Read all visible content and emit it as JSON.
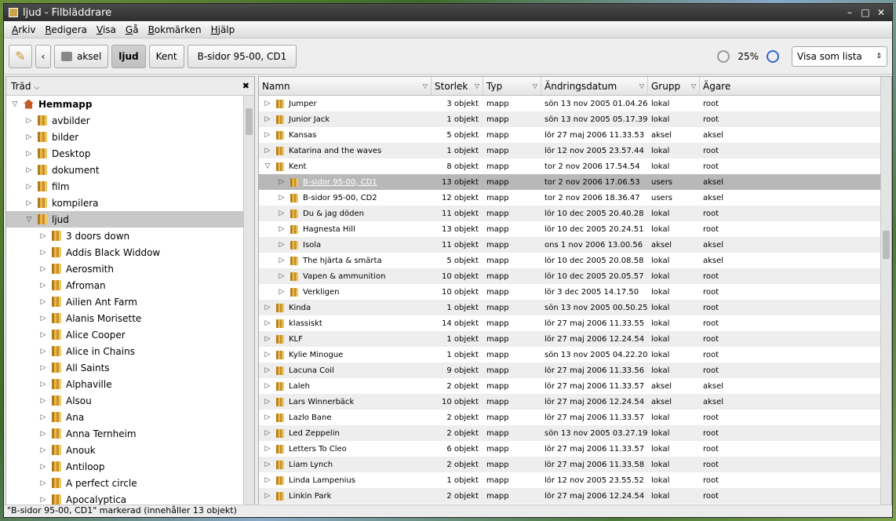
{
  "window": {
    "title": "ljud - Filbläddrare"
  },
  "menu": [
    "Arkiv",
    "Redigera",
    "Visa",
    "Gå",
    "Bokmärken",
    "Hjälp"
  ],
  "toolbar": {
    "path": [
      "aksel",
      "ljud",
      "Kent",
      "B-sidor 95-00, CD1"
    ],
    "zoom": "25%",
    "view": "Visa som lista"
  },
  "side": {
    "header": "Träd",
    "tree": [
      {
        "label": "Hemmapp",
        "depth": 0,
        "expanded": true,
        "bold": true,
        "icon": "home-icon"
      },
      {
        "label": "avbilder",
        "depth": 1
      },
      {
        "label": "bilder",
        "depth": 1
      },
      {
        "label": "Desktop",
        "depth": 1
      },
      {
        "label": "dokument",
        "depth": 1
      },
      {
        "label": "film",
        "depth": 1
      },
      {
        "label": "kompilera",
        "depth": 1
      },
      {
        "label": "ljud",
        "depth": 1,
        "expanded": true,
        "selected": true
      },
      {
        "label": "3 doors down",
        "depth": 2
      },
      {
        "label": "Addis Black Widdow",
        "depth": 2
      },
      {
        "label": "Aerosmith",
        "depth": 2
      },
      {
        "label": "Afroman",
        "depth": 2
      },
      {
        "label": "Ailien Ant Farm",
        "depth": 2
      },
      {
        "label": "Alanis Morisette",
        "depth": 2
      },
      {
        "label": "Alice Cooper",
        "depth": 2
      },
      {
        "label": "Alice in Chains",
        "depth": 2
      },
      {
        "label": "All Saints",
        "depth": 2
      },
      {
        "label": "Alphaville",
        "depth": 2
      },
      {
        "label": "Alsou",
        "depth": 2
      },
      {
        "label": "Ana",
        "depth": 2
      },
      {
        "label": "Anna Ternheim",
        "depth": 2
      },
      {
        "label": "Anouk",
        "depth": 2
      },
      {
        "label": "Antiloop",
        "depth": 2
      },
      {
        "label": "A perfect circle",
        "depth": 2
      },
      {
        "label": "Apocalyptica",
        "depth": 2
      }
    ]
  },
  "columns": [
    "Namn",
    "Storlek",
    "Typ",
    "Ändringsdatum",
    "Grupp",
    "Ägare"
  ],
  "rows": [
    {
      "name": "Jumper",
      "size": "3 objekt",
      "type": "mapp",
      "date": "sön 13 nov 2005 01.04.26",
      "group": "lokal",
      "owner": "root",
      "depth": 0
    },
    {
      "name": "Junior Jack",
      "size": "1 objekt",
      "type": "mapp",
      "date": "sön 13 nov 2005 05.17.39",
      "group": "lokal",
      "owner": "root",
      "depth": 0
    },
    {
      "name": "Kansas",
      "size": "5 objekt",
      "type": "mapp",
      "date": "lör 27 maj 2006 11.33.53",
      "group": "aksel",
      "owner": "aksel",
      "depth": 0
    },
    {
      "name": "Katarina and the waves",
      "size": "1 objekt",
      "type": "mapp",
      "date": "lör 12 nov 2005 23.57.44",
      "group": "lokal",
      "owner": "root",
      "depth": 0
    },
    {
      "name": "Kent",
      "size": "8 objekt",
      "type": "mapp",
      "date": "tor  2 nov 2006 17.54.54",
      "group": "lokal",
      "owner": "root",
      "depth": 0,
      "expanded": true
    },
    {
      "name": "B-sidor 95-00, CD1",
      "size": "13 objekt",
      "type": "mapp",
      "date": "tor  2 nov 2006 17.06.53",
      "group": "users",
      "owner": "aksel",
      "depth": 1,
      "selected": true
    },
    {
      "name": "B-sidor 95-00, CD2",
      "size": "12 objekt",
      "type": "mapp",
      "date": "tor  2 nov 2006 18.36.47",
      "group": "users",
      "owner": "aksel",
      "depth": 1
    },
    {
      "name": "Du & jag döden",
      "size": "11 objekt",
      "type": "mapp",
      "date": "lör 10 dec 2005 20.40.28",
      "group": "lokal",
      "owner": "root",
      "depth": 1
    },
    {
      "name": "Hagnesta Hill",
      "size": "13 objekt",
      "type": "mapp",
      "date": "lör 10 dec 2005 20.24.51",
      "group": "lokal",
      "owner": "root",
      "depth": 1
    },
    {
      "name": "Isola",
      "size": "11 objekt",
      "type": "mapp",
      "date": "ons  1 nov 2006 13.00.56",
      "group": "aksel",
      "owner": "aksel",
      "depth": 1
    },
    {
      "name": "The hjärta & smärta",
      "size": "5 objekt",
      "type": "mapp",
      "date": "lör 10 dec 2005 20.08.58",
      "group": "lokal",
      "owner": "aksel",
      "depth": 1
    },
    {
      "name": "Vapen & ammunition",
      "size": "10 objekt",
      "type": "mapp",
      "date": "lör 10 dec 2005 20.05.57",
      "group": "lokal",
      "owner": "root",
      "depth": 1
    },
    {
      "name": "Verkligen",
      "size": "10 objekt",
      "type": "mapp",
      "date": "lör  3 dec 2005 14.17.50",
      "group": "lokal",
      "owner": "root",
      "depth": 1
    },
    {
      "name": "Kinda",
      "size": "1 objekt",
      "type": "mapp",
      "date": "sön 13 nov 2005 00.50.25",
      "group": "lokal",
      "owner": "root",
      "depth": 0
    },
    {
      "name": "klassiskt",
      "size": "14 objekt",
      "type": "mapp",
      "date": "lör 27 maj 2006 11.33.55",
      "group": "lokal",
      "owner": "root",
      "depth": 0
    },
    {
      "name": "KLF",
      "size": "1 objekt",
      "type": "mapp",
      "date": "lör 27 maj 2006 12.24.54",
      "group": "lokal",
      "owner": "root",
      "depth": 0
    },
    {
      "name": "Kylie Minogue",
      "size": "1 objekt",
      "type": "mapp",
      "date": "sön 13 nov 2005 04.22.20",
      "group": "lokal",
      "owner": "root",
      "depth": 0
    },
    {
      "name": "Lacuna Coil",
      "size": "9 objekt",
      "type": "mapp",
      "date": "lör 27 maj 2006 11.33.56",
      "group": "lokal",
      "owner": "root",
      "depth": 0
    },
    {
      "name": "Laleh",
      "size": "2 objekt",
      "type": "mapp",
      "date": "lör 27 maj 2006 11.33.57",
      "group": "aksel",
      "owner": "aksel",
      "depth": 0
    },
    {
      "name": "Lars Winnerbäck",
      "size": "10 objekt",
      "type": "mapp",
      "date": "lör 27 maj 2006 12.24.54",
      "group": "aksel",
      "owner": "aksel",
      "depth": 0
    },
    {
      "name": "Lazlo Bane",
      "size": "2 objekt",
      "type": "mapp",
      "date": "lör 27 maj 2006 11.33.57",
      "group": "lokal",
      "owner": "root",
      "depth": 0
    },
    {
      "name": "Led Zeppelin",
      "size": "2 objekt",
      "type": "mapp",
      "date": "sön 13 nov 2005 03.27.19",
      "group": "lokal",
      "owner": "root",
      "depth": 0
    },
    {
      "name": "Letters To Cleo",
      "size": "6 objekt",
      "type": "mapp",
      "date": "lör 27 maj 2006 11.33.57",
      "group": "lokal",
      "owner": "root",
      "depth": 0
    },
    {
      "name": "Liam Lynch",
      "size": "2 objekt",
      "type": "mapp",
      "date": "lör 27 maj 2006 11.33.58",
      "group": "lokal",
      "owner": "root",
      "depth": 0
    },
    {
      "name": "Linda Lampenius",
      "size": "1 objekt",
      "type": "mapp",
      "date": "lör 12 nov 2005 23.55.52",
      "group": "lokal",
      "owner": "root",
      "depth": 0
    },
    {
      "name": "Linkin Park",
      "size": "2 objekt",
      "type": "mapp",
      "date": "lör 27 maj 2006 12.24.54",
      "group": "lokal",
      "owner": "root",
      "depth": 0
    }
  ],
  "status": "\"B-sidor 95-00, CD1\" markerad (innehåller 13 objekt)"
}
